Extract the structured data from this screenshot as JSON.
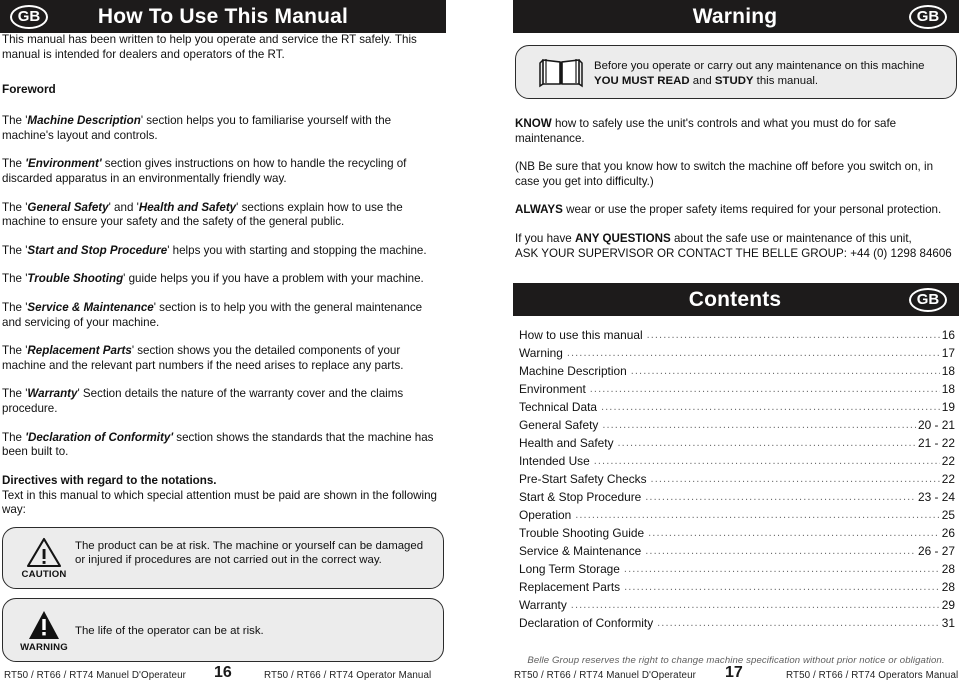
{
  "left_page": {
    "header": {
      "badge": "GB",
      "title": "How To Use This Manual"
    },
    "intro": "This manual has been written to help you operate and service the RT safely. This manual is intended for dealers and operators of the RT.",
    "foreword_heading": "Foreword",
    "paragraphs": [
      {
        "pre": "The '",
        "emph": "Machine Description",
        "post": "' section helps you to familiarise yourself with the machine's layout and controls."
      },
      {
        "pre": "The ",
        "emph": "'Environment'",
        "post": " section gives instructions on how to handle the recycling of discarded apparatus in an environmentally friendly way."
      },
      {
        "pre": "The '",
        "emph": "General Safety",
        "mid": "' and '",
        "emph2": "Health and Safety",
        "post": "' sections explain how to use the machine to ensure your safety and the safety of the general public."
      },
      {
        "pre": "The '",
        "emph": "Start and Stop Procedure",
        "post": "' helps you with starting and stopping the machine."
      },
      {
        "pre": "The '",
        "emph": "Trouble Shooting",
        "post": "' guide helps you if you have a problem with your machine."
      },
      {
        "pre": "The '",
        "emph": "Service & Maintenance",
        "post": "' section is to help you with the general maintenance and servicing of your machine."
      },
      {
        "pre": "The '",
        "emph": "Replacement Parts",
        "post": "' section shows you the detailed components of your machine and the relevant part numbers if the need arises to replace any parts."
      },
      {
        "pre": "The '",
        "emph": "Warranty",
        "post": "' Section details the nature of the warranty cover and the claims procedure."
      },
      {
        "pre": "The  ",
        "emph": "'Declaration of Conformity'",
        "post": " section shows the standards that the machine has been built to."
      }
    ],
    "directives_heading": "Directives with regard to the notations.",
    "directives_text": "Text in this manual to which special attention must be paid are shown in the following way:",
    "caution_box": {
      "icon": "warning-triangle-outline-icon",
      "label": "CAUTION",
      "text": "The product can be at risk. The machine or yourself can be damaged or injured if procedures are not carried out  in the correct way."
    },
    "warning_box": {
      "icon": "warning-triangle-solid-icon",
      "label": "WARNING",
      "text": "The life of the operator can be at risk."
    }
  },
  "right_page": {
    "header": {
      "title": "Warning",
      "badge": "GB"
    },
    "read_box": {
      "icon": "open-book-icon",
      "pre": "Before you operate or carry out any maintenance on this machine ",
      "bold1": "YOU MUST READ ",
      "mid": " and ",
      "bold2": "STUDY",
      "post": " this manual."
    },
    "notes": [
      {
        "bold": "KNOW",
        "text": " how to safely use the unit's controls and what you must do for safe maintenance."
      },
      {
        "bold": "",
        "text": "(NB Be sure that you know how to switch the machine off before you switch on, in case you get into difficulty.)"
      },
      {
        "bold": "ALWAYS",
        "text": " wear or use the proper safety items required for your personal protection."
      }
    ],
    "questions": {
      "pre": "If you have ",
      "bold": "ANY QUESTIONS",
      "post": " about the safe use or maintenance of this unit,",
      "line2": "ASK YOUR SUPERVISOR OR CONTACT THE BELLE GROUP:  +44 (0) 1298 84606"
    },
    "contents_header": {
      "title": "Contents",
      "badge": "GB"
    },
    "contents": [
      {
        "label": "How to use this manual",
        "page": "16"
      },
      {
        "label": "Warning",
        "page": "17"
      },
      {
        "label": "Machine Description",
        "page": "18"
      },
      {
        "label": "Environment",
        "page": "18"
      },
      {
        "label": "Technical Data",
        "page": "19"
      },
      {
        "label": "General Safety",
        "page": "20 - 21"
      },
      {
        "label": "Health and Safety",
        "page": "21 - 22"
      },
      {
        "label": "Intended Use",
        "page": "22"
      },
      {
        "label": "Pre-Start Safety Checks",
        "page": "22"
      },
      {
        "label": "Start & Stop Procedure",
        "page": "23 - 24"
      },
      {
        "label": "Operation",
        "page": "25"
      },
      {
        "label": "Trouble Shooting Guide",
        "page": "26"
      },
      {
        "label": "Service & Maintenance",
        "page": "26 - 27"
      },
      {
        "label": "Long Term Storage",
        "page": "28"
      },
      {
        "label": "Replacement Parts",
        "page": "28"
      },
      {
        "label": "Warranty",
        "page": "29"
      },
      {
        "label": "Declaration of Conformity",
        "page": "31"
      }
    ],
    "disclaimer": "Belle Group reserves the right to change machine specification without prior notice or obligation."
  },
  "footer": {
    "left_manual": "RT50 / RT66 / RT74 Manuel D'Operateur",
    "left_page_no": "16",
    "left_manual_en": "RT50 / RT66 / RT74 Operator Manual",
    "right_manual": "RT50 / RT66 / RT74 Manuel D'Operateur",
    "right_page_no": "17",
    "right_manual_en": "RT50 / RT66 / RT74 Operators Manual"
  }
}
